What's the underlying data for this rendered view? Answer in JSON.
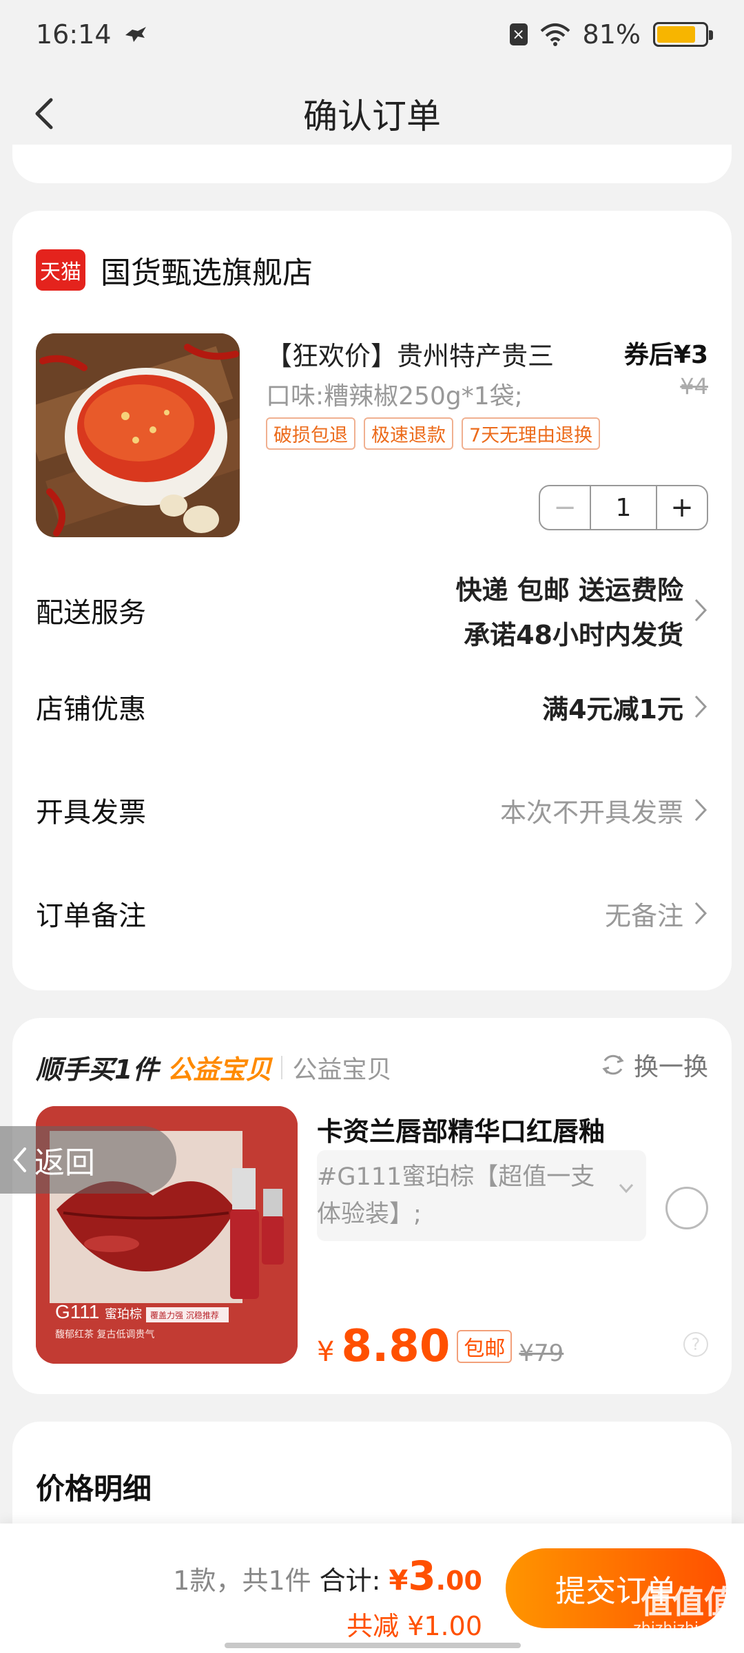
{
  "status_bar": {
    "time": "16:14",
    "battery": "81%"
  },
  "nav": {
    "title": "确认订单"
  },
  "order": {
    "shop_name": "国货甄选旗舰店",
    "shop_badge": "天猫",
    "product": {
      "title": "【狂欢价】贵州特产贵三",
      "price_label": "券后¥3",
      "original_price": "¥4",
      "spec": "口味:糟辣椒250g*1袋;",
      "tags": [
        "破损包退",
        "极速退款",
        "7天无理由退换"
      ],
      "quantity": "1",
      "minus": "−",
      "plus": "+"
    },
    "delivery": {
      "label": "配送服务",
      "line1": "快递 包邮 送运费险",
      "line2": "承诺48小时内发货"
    },
    "discount": {
      "label": "店铺优惠",
      "value": "满4元减1元"
    },
    "invoice": {
      "label": "开具发票",
      "value": "本次不开具发票"
    },
    "note": {
      "label": "订单备注",
      "value": "无备注"
    }
  },
  "addon": {
    "title": "顺手买1件",
    "accent": "公益宝贝",
    "subtitle": "公益宝贝",
    "swap_label": "换一换",
    "item_title": "卡资兰唇部精华口红唇釉",
    "sku": "#G111蜜珀棕【超值一支体验装】;",
    "currency": "¥",
    "price": "8.80",
    "ship_badge": "包邮",
    "original_price": "¥79",
    "image_text": {
      "code": "G111",
      "name": "蜜珀棕",
      "tag": "覆盖力强 沉稳推荐",
      "desc": "馥郁红茶 复古低调贵气"
    }
  },
  "float_back": {
    "label": "返回"
  },
  "price_detail": {
    "title": "价格明细"
  },
  "bottom": {
    "count": "1款，共1件",
    "total_label": "合计:",
    "currency": "¥",
    "total_int": "3",
    "total_dec": ".00",
    "saved": "共减 ¥1.00",
    "submit": "提交订单"
  },
  "watermark": {
    "main": "值值值",
    "sub": "zhizhizhi.com"
  },
  "colors": {
    "accent": "#ff5000",
    "orange": "#ff8a00",
    "tmall": "#e4231d"
  }
}
